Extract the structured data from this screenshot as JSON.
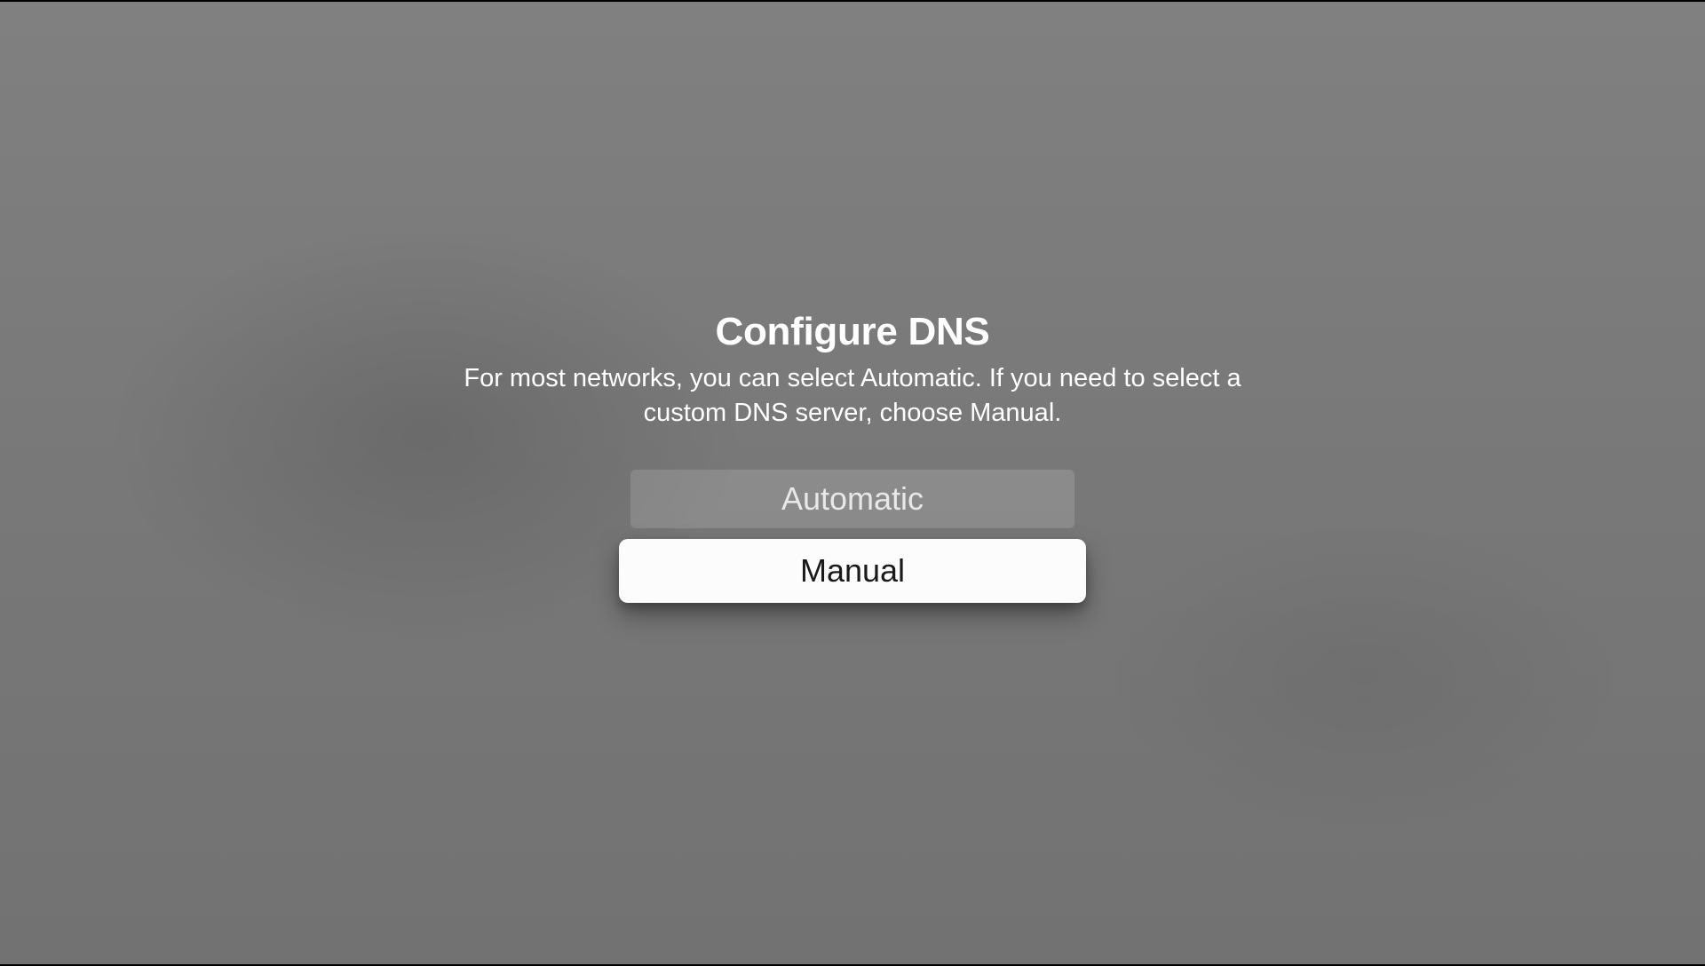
{
  "dialog": {
    "title": "Configure DNS",
    "subtitle": "For most networks, you can select Automatic. If you need to select a custom DNS server, choose Manual.",
    "options": {
      "automatic": "Automatic",
      "manual": "Manual"
    },
    "selected": "manual"
  }
}
